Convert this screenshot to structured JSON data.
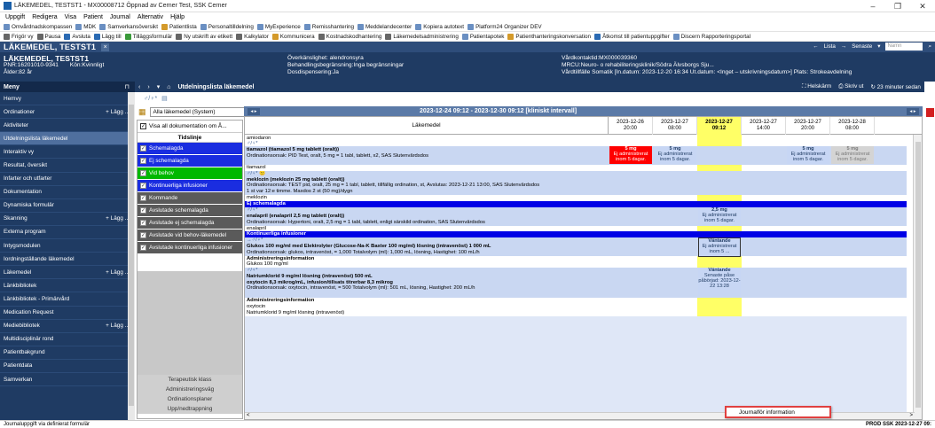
{
  "window": {
    "title": "LÄKEMEDEL, TESTST1 - MX00008712 Öppnad av Cerner Test, SSK Cerner",
    "controls": [
      "–",
      "❐",
      "✕"
    ]
  },
  "menubar": [
    "Uppgift",
    "Redigera",
    "Visa",
    "Patient",
    "Journal",
    "Alternativ",
    "Hjälp"
  ],
  "toolbar1": [
    {
      "label": "Omvårdnadskompassen",
      "color": "#6a8fc2"
    },
    {
      "label": "MDK",
      "color": "#6a8fc2"
    },
    {
      "label": "Samverkansöversikt",
      "color": "#6a8fc2"
    },
    {
      "label": "Patientlista",
      "color": "#d49a2a"
    },
    {
      "label": "Personaltilldelning",
      "color": "#6a8fc2"
    },
    {
      "label": "MyExperience",
      "color": "#6a8fc2"
    },
    {
      "label": "Remisshantering",
      "color": "#6a8fc2"
    },
    {
      "label": "Meddelandecenter",
      "color": "#6a8fc2"
    },
    {
      "label": "Kopiera autotext",
      "color": "#6a8fc2"
    },
    {
      "label": "Platform24 Organizer DEV",
      "color": "#6a8fc2"
    }
  ],
  "toolbar2": [
    {
      "label": "Frigör vy",
      "color": "#666666"
    },
    {
      "label": "Pausa",
      "color": "#666666"
    },
    {
      "label": "Avsluta",
      "color": "#2a6ab3"
    },
    {
      "label": "Lägg till",
      "color": "#2a6ab3"
    },
    {
      "label": "Tilläggsformulär",
      "color": "#3a9a3a"
    },
    {
      "label": "Ny utskrift av etikett",
      "color": "#666666"
    },
    {
      "label": "Kalkylator",
      "color": "#666666"
    },
    {
      "label": "Kommunicera",
      "color": "#d49a2a"
    },
    {
      "label": "Kostnadskodhantering",
      "color": "#666666"
    },
    {
      "label": "Läkemedelsadministrering",
      "color": "#666666"
    },
    {
      "label": "Patientapotek",
      "color": "#6a8fc2"
    },
    {
      "label": "Patienthanteringskonversation",
      "color": "#d49a2a"
    },
    {
      "label": "Åtkomst till patientuppgifter",
      "color": "#2a6ab3"
    },
    {
      "label": "Discern Rapporteringsportal",
      "color": "#6a8fc2"
    }
  ],
  "patient_header": {
    "name_tab": "LÄKEMEDEL, TESTST1",
    "lista": "Lista",
    "senaste": "Senaste",
    "name_placeholder": "Namn"
  },
  "banner": {
    "name": "LÄKEMEDEL, TESTST1",
    "pnr": "PNR:16201010-9341",
    "kon": "Kön:Kvinnligt",
    "alder": "Ålder:82 år",
    "overkanslighet": "Överkänslighet: alendronsyra",
    "behandling": "Behandlingsbegränsning:Inga begränsningar",
    "dosdispensering": "Dosdispensering:Ja",
    "vardkontakt": "Vårdkontaktid:MX000039360",
    "mrcu": "MRCU:Neuro- o rehabiliteringsklinik/Södra Älvsborgs Sju...",
    "vardtillfalle": "Vårdtillfälle Somatik [In.datum: 2023-12-20 16:34 Ut.datum: <Inget – utskrivningsdatum>] Plats: Strokeavdelning"
  },
  "sidebar": {
    "menu_title": "Meny",
    "items": [
      {
        "label": "Hemvy",
        "add": ""
      },
      {
        "label": "Ordinationer",
        "add": "+ Lägg ..."
      },
      {
        "label": "Aktiviteter",
        "add": ""
      },
      {
        "label": "Utdelningslista läkemedel",
        "add": ""
      },
      {
        "label": "Interaktiv vy",
        "add": ""
      },
      {
        "label": "Resultat, översikt",
        "add": ""
      },
      {
        "label": "Infarter och utfarter",
        "add": ""
      },
      {
        "label": "Dokumentation",
        "add": ""
      },
      {
        "label": "Dynamiska formulär",
        "add": ""
      },
      {
        "label": "Skanning",
        "add": "+ Lägg ..."
      },
      {
        "label": "Externa program",
        "add": ""
      },
      {
        "label": "Intygsmodulen",
        "add": ""
      },
      {
        "label": "Iordningställande läkemedel",
        "add": ""
      },
      {
        "label": "Läkemedel",
        "add": "+ Lägg ..."
      },
      {
        "label": "Länkbibliotek",
        "add": ""
      },
      {
        "label": "Länkbibliotek - Primärvård",
        "add": ""
      },
      {
        "label": "Medication Request",
        "add": ""
      },
      {
        "label": "Mediebibliotek",
        "add": "+ Lägg ..."
      },
      {
        "label": "Multidisciplinär rond",
        "add": ""
      },
      {
        "label": "Patientbakgrund",
        "add": ""
      },
      {
        "label": "Patientdata",
        "add": ""
      },
      {
        "label": "Samverkan",
        "add": ""
      }
    ]
  },
  "content": {
    "title": "Utdelningslista läkemedel",
    "helskarm": "Helskärm",
    "skriv_ut": "Skriv ut",
    "updated": "23 minuter sedan",
    "filter_value": "Alla läkemedel (System)",
    "visa_all": "Visa all dokumentation om Å...",
    "tidslinje": "Tidslinje",
    "time_range": "2023-12-24 09:12 - 2023-12-30 09:12 [kliniskt intervall]",
    "lakemedel_header": "Läkemedel",
    "categories": [
      {
        "label": "Schemalagda",
        "color": "#1a2de0"
      },
      {
        "label": "Ej schemalagda",
        "color": "#1a2de0"
      },
      {
        "label": "Vid behov",
        "color": "#00b800"
      },
      {
        "label": "Kontinuerliga infusioner",
        "color": "#1a2de0"
      },
      {
        "label": "Kommande",
        "color": "#5a5a5a"
      },
      {
        "label": "Avslutade schemalagda",
        "color": "#5a5a5a"
      },
      {
        "label": "Avslutade ej schemalagda",
        "color": "#5a5a5a"
      },
      {
        "label": "Avslutade vid behov-läkemedel",
        "color": "#5a5a5a"
      },
      {
        "label": "Avslutade kontinuerliga infusioner",
        "color": "#5a5a5a"
      }
    ],
    "left_footer": [
      "Terapeutisk klass",
      "Administreringsväg",
      "Ordinationsplaner",
      "Upp/nedtrappning"
    ],
    "date_cols": [
      {
        "d": "2023-12-26",
        "t": "20:00"
      },
      {
        "d": "2023-12-27",
        "t": "08:00"
      },
      {
        "d": "2023-12-27",
        "t": "09:12"
      },
      {
        "d": "2023-12-27",
        "t": "14:00"
      },
      {
        "d": "2023-12-27",
        "t": "20:00"
      },
      {
        "d": "2023-12-28",
        "t": "08:00"
      }
    ],
    "rows": {
      "r1": "amiodaron",
      "r2": "♂/♀*",
      "r3": "tiamazol (tiamazol 5 mg tablett (oralt))",
      "r4": "Ordinationsorsak: PID Test, oralt, 5 mg = 1 tabl, tablett, x2, SÄS Slutenvårdsdos",
      "r5": "tiamazol",
      "r6": "♂/♀* 😐",
      "r7": "meklozin (meklozin 25 mg tablett (oralt))",
      "r8": "Ordinationsorsak: TEST pid, oralt, 25 mg = 1 tabl, tablett, tillfällig ordination, st, Avslutas: 2023-12-21 13:00, SÄS Slutenvårdsdos",
      "r9": "1 st var 12:e timme. Maxdos 2 st (50 mg)/dygn",
      "r10": "meklozin",
      "band1": "Ej schemalagda",
      "r11": "♂/♀*",
      "r12": "enalapril (enalapril 2,5 mg tablett (oralt))",
      "r13": "Ordinationsorsak: Hypertoni, oralt, 2,5 mg = 1 tabl, tablett, enligt särskild ordination, SÄS Slutenvårdsdos",
      "r14": "enalapril",
      "band2": "Kontinuerliga infusioner",
      "r15": "→♂/♀*",
      "r16": "Glukos 100 mg/ml med Elektrolyter (Glucose-Na-K Baxter 100 mg/ml) lösning (intravenöst) 1 000 mL",
      "r17": "Ordinationsorsak: glukos, intravenöst, = 1,000 Totalvolym (ml): 1,000 mL, lösning, Hastighet: 100 mL/h",
      "r18": "Administreringsinformation",
      "r19": "Glukos 100 mg/ml",
      "r20": "♂/♀*",
      "r21": "Natriumklorid 9 mg/ml lösning (intravenöst) 500 mL",
      "r22": "oxytocin 8,3 mikrog/mL, infusion/tillsats titrerbar 8,3 mikrog",
      "r23": "Ordinationsorsak: oxytocin, intravenöst, = 500 Totalvolym (ml): 501 mL, lösning, Hastighet: 200 mL/h",
      "r24": "Administreringsinformation",
      "r25": "oxytocin",
      "r26": "Natriumklorid 9 mg/ml lösning (intravenöst)"
    },
    "cells": {
      "t1_amt": "5 mg",
      "t1_txt": "Ej administrerat inom 5 dagar.",
      "t2_amt": "5 mg",
      "t2_txt": "Ej administrerat inom 5 dagar.",
      "t3_amt": "5 mg",
      "t3_txt": "Ej administrerat inom 5 dagar.",
      "t4_amt": "5 mg",
      "t4_txt": "Ej administrerat inom 5 dagar.",
      "e1_amt": "2,5 mg",
      "e1_txt": "Ej administrerat inom 5 dagar.",
      "g1_amt": "Väntande",
      "g1_txt": "Ej administrerat inom 5 ...",
      "n1_amt": "Väntande",
      "n1_txt": "Senaste påse påbörjad: 2023-12-22 13:28"
    },
    "context_menu": "Journalför information",
    "hscroll_left": "<",
    "hscroll_right": ">"
  },
  "statusbar": {
    "left": "Journaluppgift via definierat formulär",
    "right": "PROD  SSK  2023-12-27  09:"
  }
}
